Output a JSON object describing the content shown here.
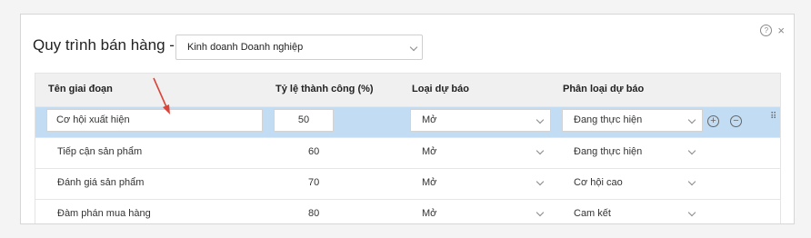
{
  "header": {
    "title": "Quy trình bán hàng -",
    "process_select_value": "Kinh doanh Doanh nghiệp",
    "help_glyph": "?",
    "close_glyph": "×"
  },
  "table": {
    "columns": [
      "Tên giai đoạn",
      "Tỷ lệ thành công (%)",
      "Loại dự báo",
      "Phân loại dự báo"
    ],
    "rows": [
      {
        "stage": "Cơ hội xuất hiện",
        "rate": "50",
        "forecast_type": "Mở",
        "forecast_category": "Đang thực hiện",
        "selected": true
      },
      {
        "stage": "Tiếp cận sản phẩm",
        "rate": "60",
        "forecast_type": "Mở",
        "forecast_category": "Đang thực hiện",
        "selected": false
      },
      {
        "stage": "Đánh giá sản phẩm",
        "rate": "70",
        "forecast_type": "Mở",
        "forecast_category": "Cơ hội cao",
        "selected": false
      },
      {
        "stage": "Đàm phán mua hàng",
        "rate": "80",
        "forecast_type": "Mở",
        "forecast_category": "Cam kết",
        "selected": false
      }
    ]
  },
  "row_actions": {
    "add_glyph": "+",
    "remove_glyph": "−",
    "drag_glyph": "⠿"
  },
  "colors": {
    "selected_row": "#c2dcf3",
    "header_bg": "#f0f0f0",
    "annotation_arrow": "#d9443a"
  }
}
